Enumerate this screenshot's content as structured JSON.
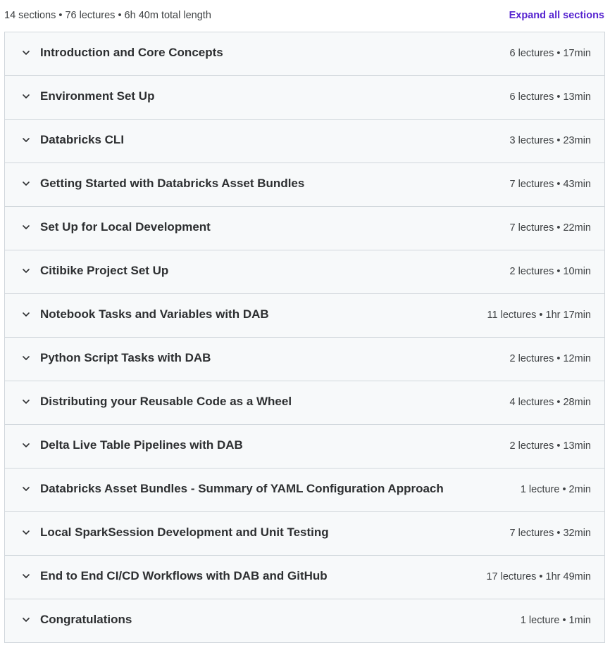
{
  "curriculum": {
    "summary": "14 sections • 76 lectures • 6h 40m total length",
    "expand_all_label": "Expand all sections",
    "accent_color": "#5624d0",
    "sections": [
      {
        "title": "Introduction and Core Concepts",
        "meta": "6 lectures • 17min"
      },
      {
        "title": "Environment Set Up",
        "meta": "6 lectures • 13min"
      },
      {
        "title": "Databricks CLI",
        "meta": "3 lectures • 23min"
      },
      {
        "title": "Getting Started with Databricks Asset Bundles",
        "meta": "7 lectures • 43min"
      },
      {
        "title": "Set Up for Local Development",
        "meta": "7 lectures • 22min"
      },
      {
        "title": "Citibike Project Set Up",
        "meta": "2 lectures • 10min"
      },
      {
        "title": "Notebook Tasks and Variables with DAB",
        "meta": "11 lectures • 1hr 17min"
      },
      {
        "title": "Python Script Tasks with DAB",
        "meta": "2 lectures • 12min"
      },
      {
        "title": "Distributing your Reusable Code as a Wheel",
        "meta": "4 lectures • 28min"
      },
      {
        "title": "Delta Live Table Pipelines with DAB",
        "meta": "2 lectures • 13min"
      },
      {
        "title": "Databricks Asset Bundles - Summary of YAML Configuration Approach",
        "meta": "1 lecture • 2min"
      },
      {
        "title": "Local SparkSession Development and Unit Testing",
        "meta": "7 lectures • 32min"
      },
      {
        "title": "End to End CI/CD Workflows with DAB and GitHub",
        "meta": "17 lectures • 1hr 49min"
      },
      {
        "title": "Congratulations",
        "meta": "1 lecture • 1min"
      }
    ]
  }
}
